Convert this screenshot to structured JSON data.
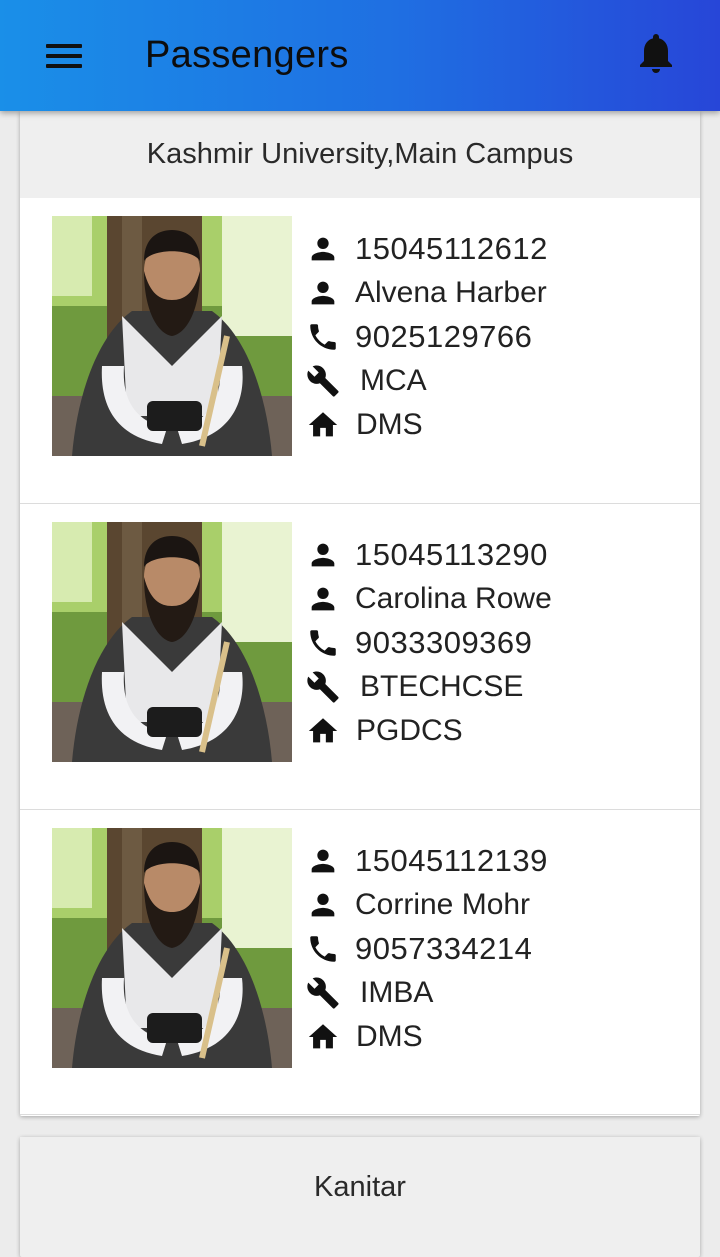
{
  "app_bar": {
    "title": "Passengers",
    "menu_icon": "menu-icon",
    "notification_icon": "bell-icon"
  },
  "stops": [
    {
      "name": "Kashmir University,Main Campus",
      "passengers": [
        {
          "id": "15045112612",
          "name": "Alvena Harber",
          "phone": "9025129766",
          "course": "MCA",
          "department": "DMS"
        },
        {
          "id": "15045113290",
          "name": "Carolina Rowe",
          "phone": "9033309369",
          "course": "BTECHCSE",
          "department": "PGDCS"
        },
        {
          "id": "15045112139",
          "name": "Corrine Mohr",
          "phone": "9057334214",
          "course": "IMBA",
          "department": "DMS"
        }
      ]
    },
    {
      "name": "Kanitar",
      "passengers": []
    }
  ],
  "icons": {
    "id": "person-icon",
    "name": "person-icon",
    "phone": "phone-icon",
    "course": "wrench-icon",
    "department": "home-icon"
  },
  "colors": {
    "app_bar_start": "#1a8fe8",
    "app_bar_end": "#2746d8",
    "header_bg": "#efefef"
  }
}
